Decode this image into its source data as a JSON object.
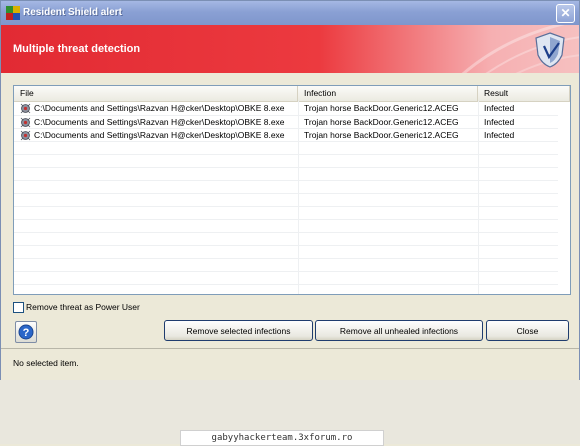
{
  "window": {
    "title": "Resident Shield alert",
    "close_symbol": "✕"
  },
  "banner": {
    "heading": "Multiple threat detection"
  },
  "table": {
    "columns": [
      "File",
      "Infection",
      "Result"
    ],
    "rows": [
      {
        "file": "C:\\Documents and Settings\\Razvan H@cker\\Desktop\\OBKE 8.exe",
        "infection": "Trojan horse BackDoor.Generic12.ACEG",
        "result": "Infected"
      },
      {
        "file": "C:\\Documents and Settings\\Razvan H@cker\\Desktop\\OBKE 8.exe",
        "infection": "Trojan horse BackDoor.Generic12.ACEG",
        "result": "Infected"
      },
      {
        "file": "C:\\Documents and Settings\\Razvan H@cker\\Desktop\\OBKE 8.exe",
        "infection": "Trojan horse BackDoor.Generic12.ACEG",
        "result": "Infected"
      }
    ]
  },
  "options": {
    "power_user_label": "Remove threat as Power User",
    "power_user_checked": false
  },
  "buttons": {
    "help_icon": "question-icon",
    "remove_selected": "Remove selected infections",
    "remove_all": "Remove all unhealed infections",
    "close": "Close"
  },
  "status": {
    "text": "No selected item."
  },
  "watermark": {
    "text": "gabyyhackerteam.3xforum.ro"
  },
  "colors": {
    "banner_red": "#e22a33",
    "titlebar_blue": "#8aa0d4"
  }
}
